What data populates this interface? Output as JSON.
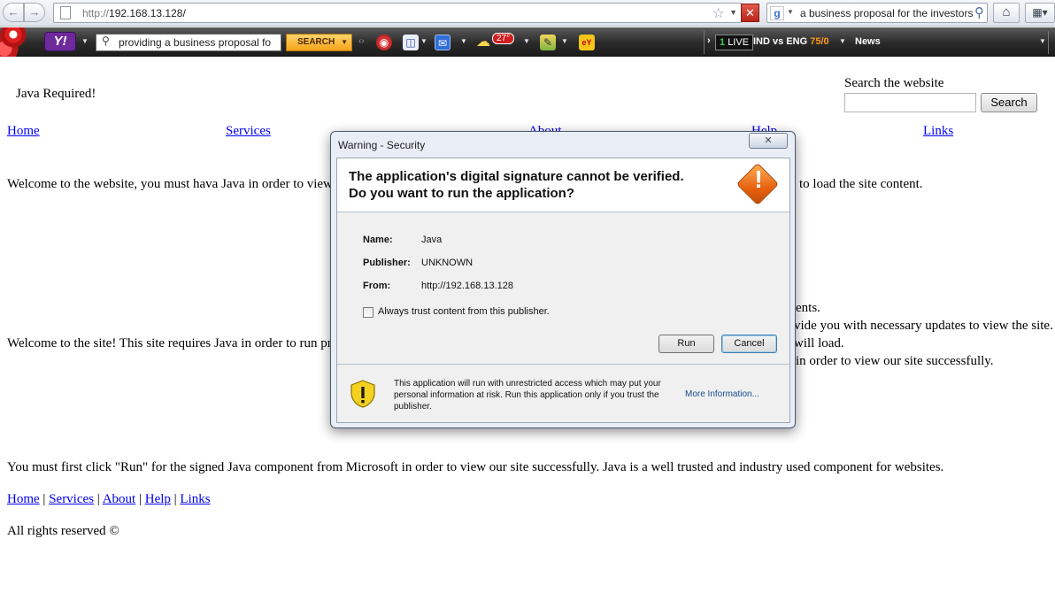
{
  "browser": {
    "url_prefix": "http://",
    "url_host": "192.168.13.128/",
    "search_text": "a business proposal for the investors",
    "search_engine_icon": "g"
  },
  "toolbar": {
    "yahoo_logo": "Y!",
    "search_value": "providing a business proposal fo",
    "search_button": "SEARCH",
    "weather_temp": "27°",
    "ebay_icon": "eY",
    "live_label": "LIVE",
    "live_indicator": "1",
    "score_teams": "IND vs ENG",
    "score_value": "75/0",
    "news_label": "News"
  },
  "page": {
    "java_required": "Java Required!",
    "search_label": "Search the website",
    "search_button": "Search",
    "nav": [
      "Home",
      "Services",
      "About",
      "Help",
      "Links"
    ],
    "para1_left": "Welcome to the website, you must hava Java in order to view",
    "para1_right": "to load the site content.",
    "para2_left": "Welcome to the site! This site requires Java in order to run pr",
    "para2_right_1": "ents.",
    "para2_right_2": "vide you with necessary updates to view the site.",
    "para2_right_3": "will load.",
    "para2_right_4": "in order to view our site successfully.",
    "para3": "You must first click \"Run\" for the signed Java component from Microsoft in order to view our site successfully. Java is a well trusted and industry used component for websites.",
    "footer_links": [
      "Home",
      "Services",
      "About",
      "Help",
      "Links"
    ],
    "footer_sep": "|",
    "copyright": "All rights reserved ©"
  },
  "dialog": {
    "title": "Warning - Security",
    "close_glyph": "✕",
    "heading_line1": "The application's digital signature cannot be verified.",
    "heading_line2": "Do you want to run the application?",
    "name_label": "Name:",
    "name_value": "Java",
    "publisher_label": "Publisher:",
    "publisher_value": "UNKNOWN",
    "from_label": "From:",
    "from_value": "http://192.168.13.128",
    "checkbox_label": "Always trust content from this publisher.",
    "run_button": "Run",
    "cancel_button": "Cancel",
    "footer_text": "This application will run with unrestricted access which may put your personal information at risk. Run this application only if you trust the publisher.",
    "more_info": "More Information..."
  },
  "colors": {
    "link": "#0000ee",
    "warning_orange": "#e7620e",
    "shield_yellow": "#f4d21f"
  }
}
